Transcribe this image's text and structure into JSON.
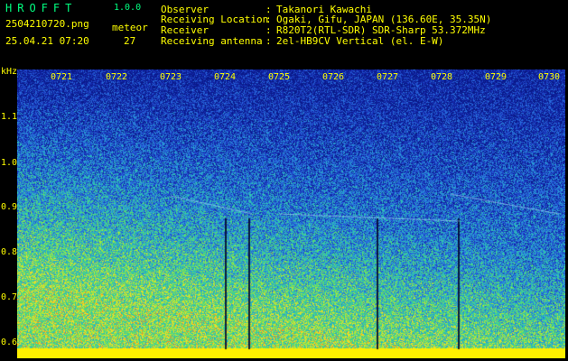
{
  "header": {
    "app_title": "HROFFT",
    "app_version": "1.0.0",
    "file_name": "2504210720.png",
    "date_time": "25.04.21 07:20",
    "meteor_label": "meteor",
    "meteor_count": "27"
  },
  "info": [
    {
      "label": "Observer",
      "value": "Takanori Kawachi"
    },
    {
      "label": "Receiving Location",
      "value": "Ogaki, Gifu, JAPAN (136.60E, 35.35N)"
    },
    {
      "label": "Receiver",
      "value": "R820T2(RTL-SDR) SDR-Sharp 53.372MHz"
    },
    {
      "label": "Receiving antenna",
      "value": "2el-HB9CV Vertical (el. E-W)"
    }
  ],
  "separator": ":",
  "frequency_axis": {
    "unit": "kHz",
    "ticks": [
      "1.1",
      "1.0",
      "0.9",
      "0.8",
      "0.7",
      "0.6"
    ]
  },
  "time_axis": {
    "ticks": [
      "0721",
      "0722",
      "0723",
      "0724",
      "0725",
      "0726",
      "0727",
      "0728",
      "0729",
      "0730"
    ]
  },
  "colors": {
    "background": "#000000",
    "label_text": "#ffff00",
    "title_text": "#00ff80",
    "spectrogram_low": "#0a1a8a",
    "spectrogram_high": "#ffff00"
  }
}
